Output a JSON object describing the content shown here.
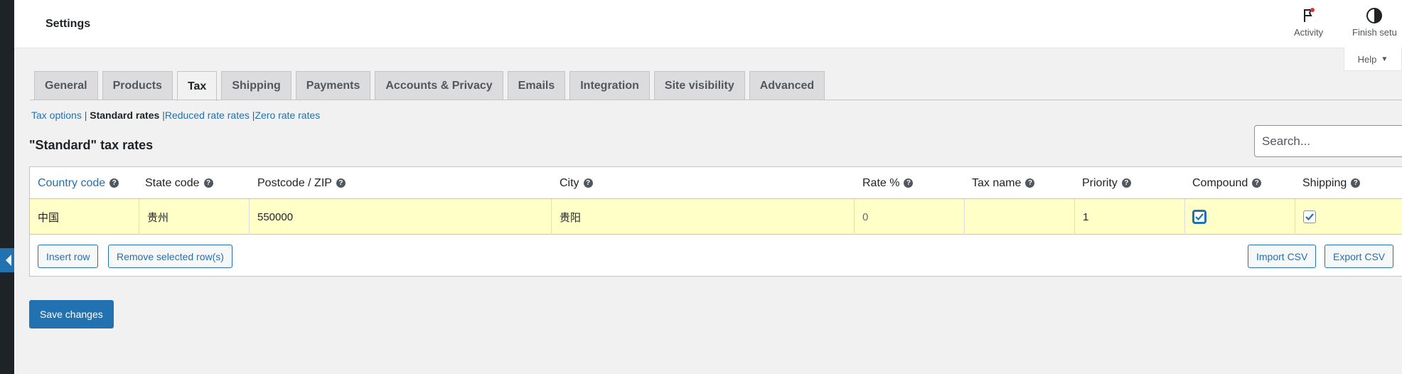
{
  "header": {
    "title": "Settings",
    "activity_label": "Activity",
    "finish_setup_label": "Finish setu",
    "help_label": "Help"
  },
  "tabs": [
    {
      "label": "General",
      "active": false
    },
    {
      "label": "Products",
      "active": false
    },
    {
      "label": "Tax",
      "active": true
    },
    {
      "label": "Shipping",
      "active": false
    },
    {
      "label": "Payments",
      "active": false
    },
    {
      "label": "Accounts & Privacy",
      "active": false
    },
    {
      "label": "Emails",
      "active": false
    },
    {
      "label": "Integration",
      "active": false
    },
    {
      "label": "Site visibility",
      "active": false
    },
    {
      "label": "Advanced",
      "active": false
    }
  ],
  "subnav": {
    "tax_options": "Tax options",
    "standard_rates": "Standard rates",
    "reduced_rates": "Reduced rate rates",
    "zero_rates": "Zero rate rates",
    "separator": "|"
  },
  "section_title": "\"Standard\" tax rates",
  "search": {
    "placeholder": "Search..."
  },
  "table": {
    "columns": [
      "Country code",
      "State code",
      "Postcode / ZIP",
      "City",
      "Rate %",
      "Tax name",
      "Priority",
      "Compound",
      "Shipping"
    ],
    "rows": [
      {
        "country": "中国",
        "state": "贵州",
        "postcode": "550000",
        "city": "贵阳",
        "rate": "0",
        "tax_name": "",
        "priority": "1",
        "compound": true,
        "shipping": true
      }
    ],
    "insert_row_label": "Insert row",
    "remove_rows_label": "Remove selected row(s)",
    "import_csv_label": "Import CSV",
    "export_csv_label": "Export CSV"
  },
  "save_label": "Save changes",
  "colors": {
    "accent": "#2271b1",
    "row_highlight": "#ffffc7"
  }
}
